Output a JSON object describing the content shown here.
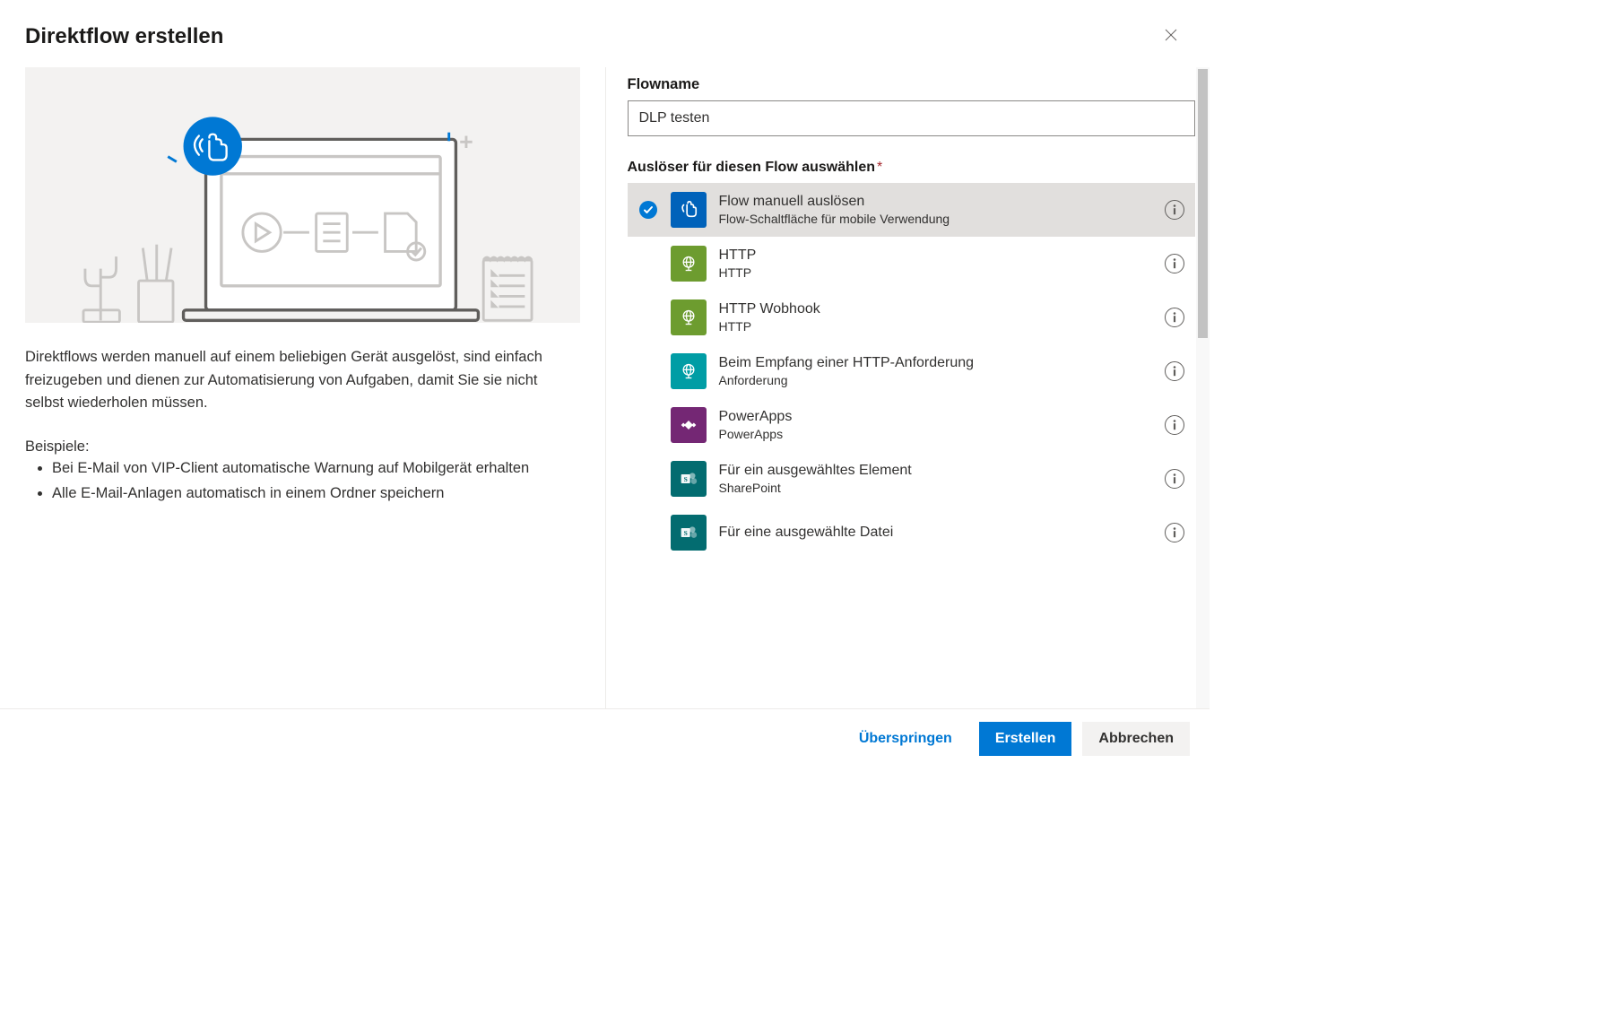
{
  "dialog": {
    "title": "Direktflow erstellen",
    "close_aria": "Close"
  },
  "left": {
    "desc": "Direktflows werden manuell auf einem beliebigen Gerät ausgelöst, sind einfach freizugeben und dienen zur Automatisierung von Aufgaben, damit Sie sie nicht selbst wiederholen müssen.",
    "examples_label": "Beispiele:",
    "examples": [
      "Bei E-Mail von VIP-Client automatische Warnung auf Mobilgerät erhalten",
      "Alle E-Mail-Anlagen automatisch in einem Ordner speichern"
    ]
  },
  "right": {
    "flowname_label": "Flowname",
    "flowname_value": "DLP testen",
    "trigger_label": "Auslöser für diesen Flow auswählen",
    "triggers": [
      {
        "title": "Flow manuell auslösen",
        "sub": "Flow-Schaltfläche für mobile Verwendung",
        "icon": "touch",
        "color": "#0062ba",
        "selected": true
      },
      {
        "title": "HTTP",
        "sub": "HTTP",
        "icon": "globe",
        "color": "#6d9c2f",
        "selected": false
      },
      {
        "title": "HTTP Wobhook",
        "sub": "HTTP",
        "icon": "globe",
        "color": "#6d9c2f",
        "selected": false
      },
      {
        "title": "Beim Empfang einer HTTP-Anforderung",
        "sub": "Anforderung",
        "icon": "globe",
        "color": "#009da5",
        "selected": false
      },
      {
        "title": "PowerApps",
        "sub": "PowerApps",
        "icon": "powerapps",
        "color": "#742774",
        "selected": false
      },
      {
        "title": "Für ein ausgewähltes Element",
        "sub": "SharePoint",
        "icon": "sharepoint",
        "color": "#036c70",
        "selected": false
      },
      {
        "title": "Für eine ausgewählte Datei",
        "sub": "",
        "icon": "sharepoint",
        "color": "#036c70",
        "selected": false
      }
    ]
  },
  "footer": {
    "skip": "Überspringen",
    "create": "Erstellen",
    "cancel": "Abbrechen"
  }
}
